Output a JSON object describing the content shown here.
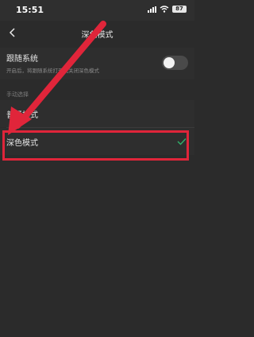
{
  "status_bar": {
    "time": "15:51",
    "battery": "87"
  },
  "nav": {
    "title": "深色模式"
  },
  "follow_system": {
    "title": "跟随系统",
    "description": "开启后，将跟随系统打开或关闭深色模式",
    "enabled": false
  },
  "manual": {
    "section_label": "手动选择",
    "options": [
      {
        "label": "普通模式",
        "selected": false
      },
      {
        "label": "深色模式",
        "selected": true
      }
    ]
  },
  "colors": {
    "highlight": "#e0253a",
    "check": "#2fb36b",
    "background": "#2b2b2b"
  }
}
